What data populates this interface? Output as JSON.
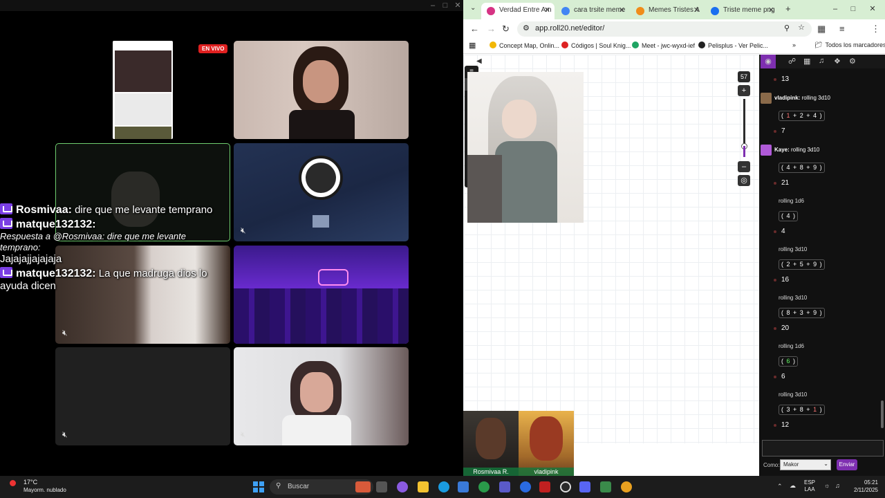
{
  "stream": {
    "live_badge": "EN VIVO",
    "chat": [
      {
        "user": "Rosmivaa:",
        "text": "dire que me levante temprano"
      },
      {
        "user": "matque132132:",
        "reply": "Respuesta a @Rosmivaa: dire que me levante temprano:",
        "text": "Jajajajjajajaja"
      },
      {
        "user": "matque132132:",
        "text": "La que madruga dios lo ayuda dicen"
      }
    ]
  },
  "browser": {
    "tabs": [
      {
        "label": "Verdad Entre Am",
        "color": "#d63384",
        "active": true
      },
      {
        "label": "cara trsite meme",
        "color": "#4285f4",
        "active": false
      },
      {
        "label": "Memes Tristes A",
        "color": "#f08c1a",
        "active": false
      },
      {
        "label": "Triste meme png",
        "color": "#1a6ff0",
        "active": false
      }
    ],
    "url": "app.roll20.net/editor/",
    "bookmarks": [
      {
        "label": "Concept Map, Onlin...",
        "color": "#f2b705"
      },
      {
        "label": "Códigos | Soul Knig...",
        "color": "#d22"
      },
      {
        "label": "Meet - jwc-wyxd-ief",
        "color": "#1fa463"
      },
      {
        "label": "Pelisplus - Ver Pelic...",
        "color": "#222"
      }
    ],
    "all_bookmarks": "Todos los marcadores"
  },
  "roll20": {
    "zoom_level": "57",
    "rolls": [
      {
        "type": "result",
        "value": "13"
      },
      {
        "type": "header",
        "who": "vladipink:",
        "label": "rolling 3d10"
      },
      {
        "type": "dice",
        "dice": [
          "1",
          "2",
          "4"
        ]
      },
      {
        "type": "result",
        "value": "7"
      },
      {
        "type": "header",
        "who": "Kaye:",
        "label": "rolling 3d10"
      },
      {
        "type": "dice",
        "dice": [
          "4",
          "8",
          "9"
        ]
      },
      {
        "type": "result",
        "value": "21"
      },
      {
        "type": "label",
        "label": "rolling 1d6"
      },
      {
        "type": "dice",
        "dice": [
          "4"
        ]
      },
      {
        "type": "result",
        "value": "4"
      },
      {
        "type": "label",
        "label": "rolling 3d10"
      },
      {
        "type": "dice",
        "dice": [
          "2",
          "5",
          "9"
        ]
      },
      {
        "type": "result",
        "value": "16"
      },
      {
        "type": "label",
        "label": "rolling 3d10"
      },
      {
        "type": "dice",
        "dice": [
          "8",
          "3",
          "9"
        ]
      },
      {
        "type": "result",
        "value": "20"
      },
      {
        "type": "label",
        "label": "rolling 1d6"
      },
      {
        "type": "dice",
        "dice": [
          "6"
        ]
      },
      {
        "type": "result",
        "value": "6"
      },
      {
        "type": "label",
        "label": "rolling 3d10"
      },
      {
        "type": "dice",
        "dice": [
          "3",
          "8",
          "1"
        ]
      },
      {
        "type": "result",
        "value": "12"
      }
    ],
    "como_label": "Como:",
    "como_value": "Makor",
    "send_label": "Enviar",
    "players": [
      {
        "name": "Rosmivaa R."
      },
      {
        "name": "vladipink"
      }
    ]
  },
  "taskbar": {
    "temperature": "17°C",
    "weather": "Mayorm. nublado",
    "search_placeholder": "Buscar",
    "lang_top": "ESP",
    "lang_bottom": "LAA",
    "time": "05:21",
    "date": "2/11/2025"
  }
}
